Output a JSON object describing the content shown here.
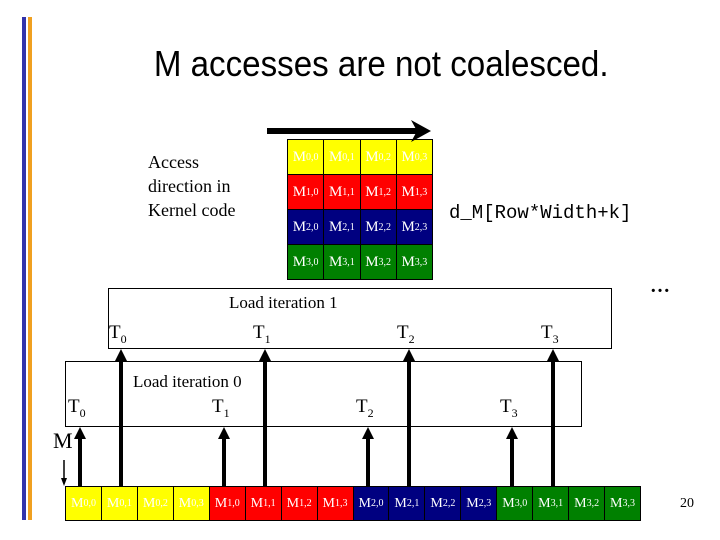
{
  "slide": {
    "title": "M accesses are not coalesced.",
    "page_number": "20",
    "accent_colors": {
      "bar_blue": "#3333aa",
      "bar_orange": "#f0a020"
    }
  },
  "access_direction": {
    "lines": [
      "Access",
      "direction in",
      "Kernel code"
    ]
  },
  "code_expression": "d_M[Row*Width+k]",
  "ellipsis": "…",
  "matrix": {
    "name": "M",
    "row_colors": [
      "#ffff00",
      "#ff0000",
      "#000080",
      "#008000"
    ],
    "text_color": "#ffffff",
    "rows": [
      [
        {
          "base": "M",
          "sub": "0,0"
        },
        {
          "base": "M",
          "sub": "0,1"
        },
        {
          "base": "M",
          "sub": "0,2"
        },
        {
          "base": "M",
          "sub": "0,3"
        }
      ],
      [
        {
          "base": "M",
          "sub": "1,0"
        },
        {
          "base": "M",
          "sub": "1,1"
        },
        {
          "base": "M",
          "sub": "1,2"
        },
        {
          "base": "M",
          "sub": "1,3"
        }
      ],
      [
        {
          "base": "M",
          "sub": "2,0"
        },
        {
          "base": "M",
          "sub": "2,1"
        },
        {
          "base": "M",
          "sub": "2,2"
        },
        {
          "base": "M",
          "sub": "2,3"
        }
      ],
      [
        {
          "base": "M",
          "sub": "3,0"
        },
        {
          "base": "M",
          "sub": "3,1"
        },
        {
          "base": "M",
          "sub": "3,2"
        },
        {
          "base": "M",
          "sub": "3,3"
        }
      ]
    ]
  },
  "linear_memory": {
    "label": "M",
    "order": [
      "0,0",
      "0,1",
      "0,2",
      "0,3",
      "1,0",
      "1,1",
      "1,2",
      "1,3",
      "2,0",
      "2,1",
      "2,2",
      "2,3",
      "3,0",
      "3,1",
      "3,2",
      "3,3"
    ]
  },
  "load_iterations": [
    {
      "label": "Load iteration 0",
      "threads": [
        {
          "base": "T",
          "sub": "0",
          "accesses": "0,0"
        },
        {
          "base": "T",
          "sub": "1",
          "accesses": "1,0"
        },
        {
          "base": "T",
          "sub": "2",
          "accesses": "2,0"
        },
        {
          "base": "T",
          "sub": "3",
          "accesses": "3,0"
        }
      ]
    },
    {
      "label": "Load iteration 1",
      "threads": [
        {
          "base": "T",
          "sub": "0",
          "accesses": "0,1"
        },
        {
          "base": "T",
          "sub": "1",
          "accesses": "1,1"
        },
        {
          "base": "T",
          "sub": "2",
          "accesses": "2,1"
        },
        {
          "base": "T",
          "sub": "3",
          "accesses": "3,1"
        }
      ]
    }
  ]
}
